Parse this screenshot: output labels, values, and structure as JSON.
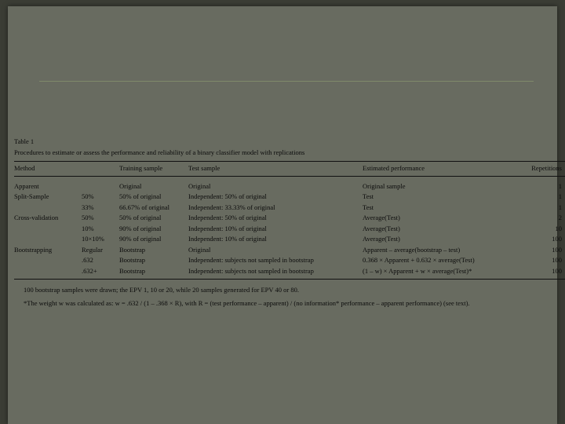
{
  "table": {
    "label": "Table 1",
    "caption": "Procedures to estimate or assess the performance and reliability of a binary classifier model with replications",
    "headers": [
      "Method",
      "",
      "Training sample",
      "Test sample",
      "Estimated performance",
      "Repetitions"
    ],
    "rows": [
      [
        "Apparent",
        "",
        "Original",
        "Original",
        "Original sample",
        "1"
      ],
      [
        "Split-Sample",
        "50%",
        "50% of original",
        "Independent: 50% of original",
        "Test",
        "1"
      ],
      [
        "",
        "33%",
        "66.67% of original",
        "Independent: 33.33% of original",
        "Test",
        "1"
      ],
      [
        "Cross-validation",
        "50%",
        "50% of original",
        "Independent: 50% of original",
        "Average(Test)",
        "2"
      ],
      [
        "",
        "10%",
        "90% of original",
        "Independent: 10% of original",
        "Average(Test)",
        "10"
      ],
      [
        "",
        "10×10%",
        "90% of original",
        "Independent: 10% of original",
        "Average(Test)",
        "100"
      ],
      [
        "Bootstrapping",
        "Regular",
        "Bootstrap",
        "Original",
        "Apparent – average(bootstrap – test)",
        "100"
      ],
      [
        "",
        ".632",
        "Bootstrap",
        "Independent: subjects not sampled in bootstrap",
        "0.368 × Apparent + 0.632 × average(Test)",
        "100"
      ],
      [
        "",
        ".632+",
        "Bootstrap",
        "Independent: subjects not sampled in bootstrap",
        "(1 – w) × Apparent + w × average(Test)*",
        "100"
      ]
    ],
    "notes": [
      "100 bootstrap samples were drawn; the EPV 1, 10 or 20, while 20 samples generated for EPV 40 or 80.",
      "*The weight w was calculated as: w = .632 / (1 – .368 × R), with R = (test performance – apparent) / (no information* performance – apparent performance) (see text)."
    ]
  }
}
